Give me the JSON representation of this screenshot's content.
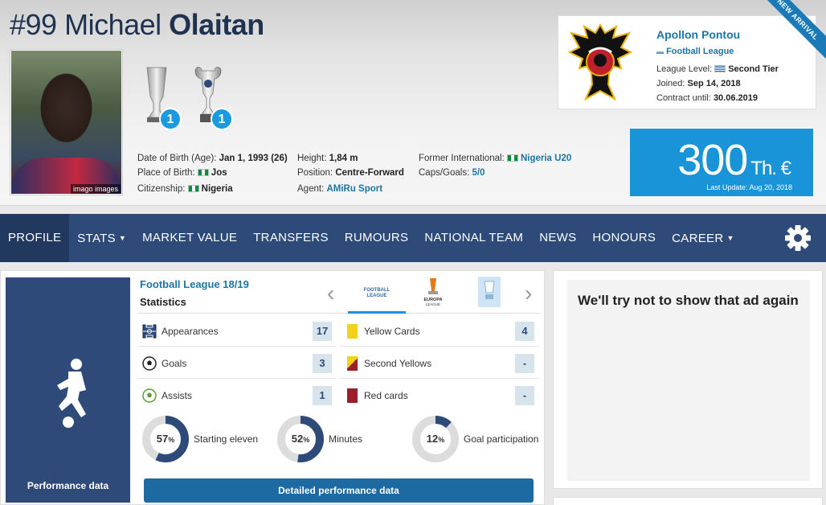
{
  "player": {
    "number": "#99",
    "first_name": "Michael",
    "last_name": "Olaitan",
    "photo_credit": "imago images",
    "trophies": [
      {
        "icon": "championship-trophy-icon",
        "count": "1"
      },
      {
        "icon": "cup-trophy-icon",
        "count": "1"
      }
    ],
    "info": {
      "dob_label": "Date of Birth (Age):",
      "dob_value": "Jan 1, 1993 (26)",
      "birthplace_label": "Place of Birth:",
      "birthplace_value": "Jos",
      "citizenship_label": "Citizenship:",
      "citizenship_value": "Nigeria",
      "height_label": "Height:",
      "height_value": "1,84 m",
      "position_label": "Position:",
      "position_value": "Centre-Forward",
      "agent_label": "Agent:",
      "agent_value": "AMiRu Sport",
      "former_intl_label": "Former International:",
      "former_intl_value": "Nigeria U20",
      "caps_label": "Caps/Goals:",
      "caps_value": "5/0"
    }
  },
  "club": {
    "name": "Apollon Pontou",
    "league": "Football League",
    "league_level_label": "League Level:",
    "league_level_value": "Second Tier",
    "joined_label": "Joined:",
    "joined_value": "Sep 14, 2018",
    "contract_label": "Contract until:",
    "contract_value": "30.06.2019",
    "ribbon": "NEW ARRIVAL"
  },
  "market_value": {
    "amount": "300",
    "unit": "Th. €",
    "updated": "Last Update: Aug 20, 2018"
  },
  "nav": {
    "items": [
      "PROFILE",
      "STATS",
      "MARKET VALUE",
      "TRANSFERS",
      "RUMOURS",
      "NATIONAL TEAM",
      "NEWS",
      "HONOURS",
      "CAREER"
    ],
    "active": "PROFILE"
  },
  "performance": {
    "side_label": "Performance data",
    "league_title": "Football League 18/19",
    "stats_title": "Statistics",
    "prev_arrow": "‹",
    "next_arrow": "›",
    "stats_left": [
      {
        "label": "Appearances",
        "value": "17",
        "icon": "pitch-icon"
      },
      {
        "label": "Goals",
        "value": "3",
        "icon": "ball-icon"
      },
      {
        "label": "Assists",
        "value": "1",
        "icon": "assist-ball-icon"
      }
    ],
    "stats_right": [
      {
        "label": "Yellow Cards",
        "value": "4",
        "icon": "yellow-card-icon"
      },
      {
        "label": "Second Yellows",
        "value": "-",
        "icon": "second-yellow-icon"
      },
      {
        "label": "Red cards",
        "value": "-",
        "icon": "red-card-icon"
      }
    ],
    "donuts": [
      {
        "percent": 57,
        "pct_text": "57",
        "label": "Starting eleven"
      },
      {
        "percent": 52,
        "pct_text": "52",
        "label": "Minutes"
      },
      {
        "percent": 12,
        "pct_text": "12",
        "label": "Goal participation"
      }
    ],
    "detail_button": "Detailed performance data"
  },
  "ad": {
    "text": "We'll try not to show that ad again"
  },
  "colors": {
    "nav_bg": "#2e4a78",
    "accent_blue": "#1a94d8",
    "link": "#1d75a3",
    "yellow_card": "#f4d21a",
    "red_card": "#9b1d28"
  }
}
